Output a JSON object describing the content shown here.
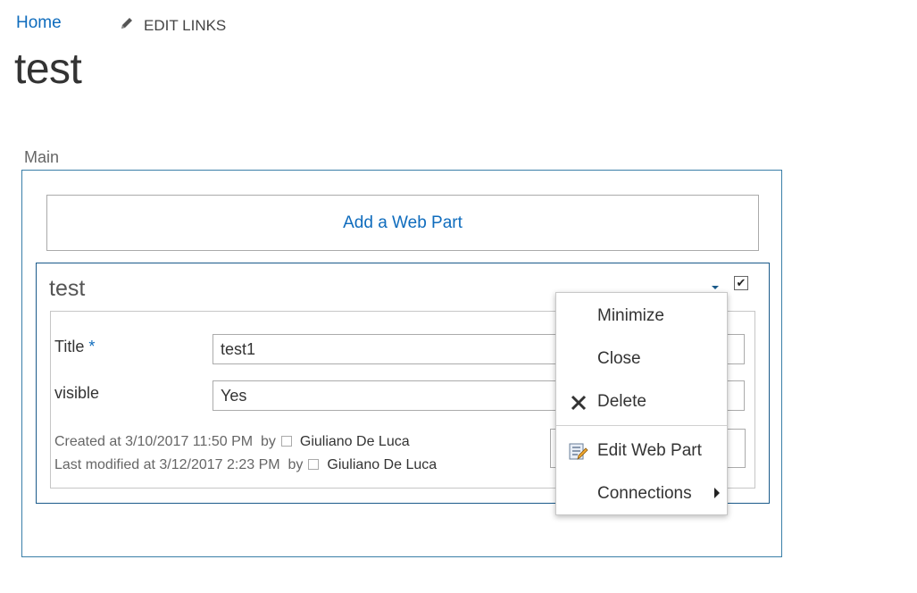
{
  "nav": {
    "home": "Home",
    "edit_links": "EDIT LINKS"
  },
  "page": {
    "title": "test"
  },
  "zone": {
    "label": "Main",
    "add_webpart": "Add a Web Part"
  },
  "webpart": {
    "title": "test",
    "fields": [
      {
        "label": "Title",
        "required_marker": "*",
        "value": "test1"
      },
      {
        "label": "visible",
        "value": "Yes"
      }
    ],
    "created": {
      "prefix": "Created at 3/10/2017 11:50 PM",
      "by": "by",
      "user": "Giuliano De Luca"
    },
    "modified": {
      "prefix": "Last modified at 3/12/2017 2:23 PM",
      "by": "by",
      "user": "Giuliano De Luca"
    },
    "checked": true
  },
  "menu": {
    "items": [
      {
        "label": "Minimize",
        "icon": ""
      },
      {
        "label": "Close",
        "icon": ""
      },
      {
        "label": "Delete",
        "icon": "delete-x-icon"
      },
      {
        "label": "Edit Web Part",
        "icon": "edit-webpart-icon"
      },
      {
        "label": "Connections",
        "icon": "",
        "submenu": true
      }
    ]
  },
  "colors": {
    "link": "#0f6cbd",
    "zone_border": "#3a7fa8",
    "webpart_border": "#1a5a8a"
  }
}
